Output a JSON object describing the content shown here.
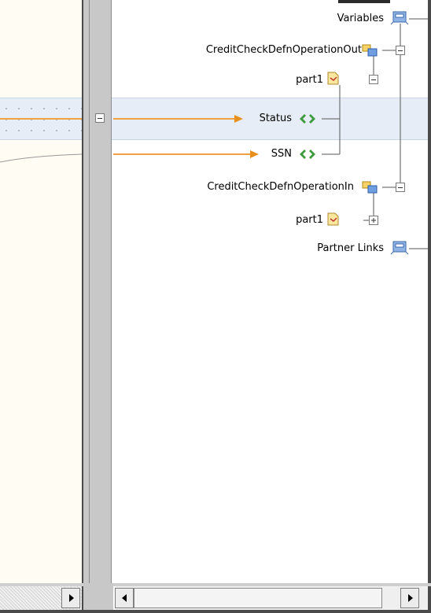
{
  "tree": {
    "variables_label": "Variables",
    "credit_out_label": "CreditCheckDefnOperationOut",
    "part1_out_label": "part1",
    "status_label": "Status",
    "ssn_label": "SSN",
    "credit_in_label": "CreditCheckDefnOperationIn",
    "part1_in_label": "part1",
    "partner_links_label": "Partner Links"
  },
  "colors": {
    "mapping_line": "#f0a040",
    "mapping_arrow": "#e8901e",
    "tree_line": "#555555",
    "band": "#e6edf6",
    "left_canvas": "#fffcf3"
  },
  "icons": [
    "variables-folder-icon",
    "message-variable-icon",
    "part-document-icon",
    "element-diamond-icon",
    "partner-links-icon",
    "expand-toggle-icon",
    "collapse-toggle-icon"
  ]
}
